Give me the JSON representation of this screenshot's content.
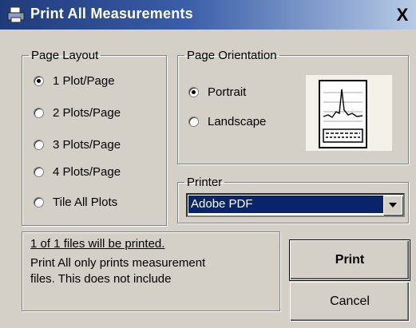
{
  "window": {
    "title": "Print All Measurements",
    "close_glyph": "X"
  },
  "page_layout": {
    "legend": "Page Layout",
    "options": [
      {
        "label": "1 Plot/Page",
        "checked": true
      },
      {
        "label": "2 Plots/Page",
        "checked": false
      },
      {
        "label": "3 Plots/Page",
        "checked": false
      },
      {
        "label": "4 Plots/Page",
        "checked": false
      },
      {
        "label": "Tile All Plots",
        "checked": false
      }
    ]
  },
  "page_orientation": {
    "legend": "Page Orientation",
    "options": [
      {
        "label": "Portrait",
        "checked": true
      },
      {
        "label": "Landscape",
        "checked": false
      }
    ]
  },
  "printer": {
    "legend": "Printer",
    "selected": "Adobe PDF"
  },
  "info": {
    "summary": "1 of 1 files will be printed.",
    "line1": "Print All only prints measurement",
    "line2": "files.  This does not include"
  },
  "buttons": {
    "print": "Print",
    "cancel": "Cancel"
  },
  "colors": {
    "title_bar_start": "#1f3b7a",
    "dialog_bg": "#d4d0c8",
    "selection": "#0a246a"
  }
}
